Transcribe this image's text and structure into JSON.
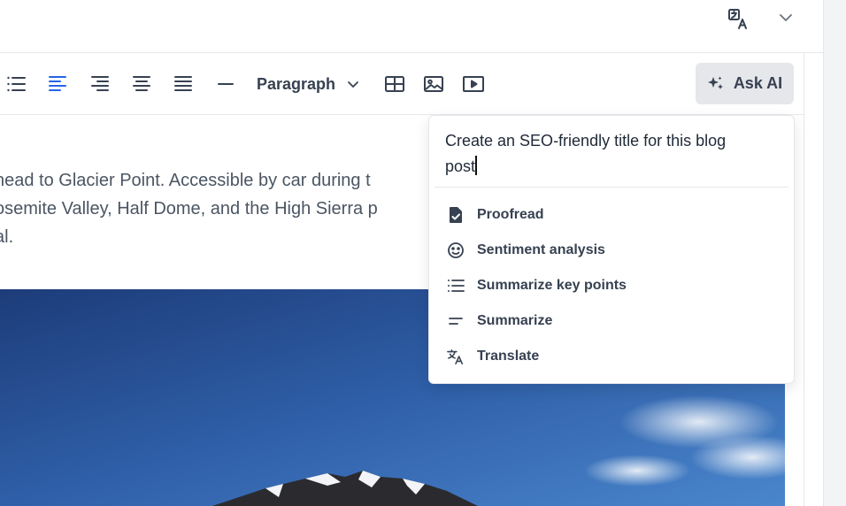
{
  "colors": {
    "accent": "#2563eb",
    "text": "#374151",
    "button_bg": "#e5e7eb"
  },
  "topbar": {
    "translate_icon": "translate-icon",
    "chevron_icon": "chevron-down-icon"
  },
  "toolbar": {
    "items": [
      "bulleted-list-icon",
      "align-left-icon",
      "align-right-icon",
      "align-center-icon",
      "align-justify-icon",
      "horizontal-rule-icon"
    ],
    "paragraph_label": "Paragraph",
    "insert_items": [
      "table-icon",
      "image-icon",
      "video-icon"
    ],
    "ask_ai_label": "Ask AI"
  },
  "content": {
    "lines": [
      "head to Glacier Point. Accessible by car during t",
      "osemite Valley, Half Dome, and the High Sierra p",
      "al."
    ]
  },
  "ai_panel": {
    "prompt_line1": "Create an SEO-friendly title for this blog",
    "prompt_line2": "post",
    "actions": [
      {
        "label": "Proofread",
        "icon": "document-check-icon"
      },
      {
        "label": "Sentiment analysis",
        "icon": "smiley-icon"
      },
      {
        "label": "Summarize key points",
        "icon": "list-icon"
      },
      {
        "label": "Summarize",
        "icon": "summary-lines-icon"
      },
      {
        "label": "Translate",
        "icon": "translate-icon"
      }
    ]
  }
}
